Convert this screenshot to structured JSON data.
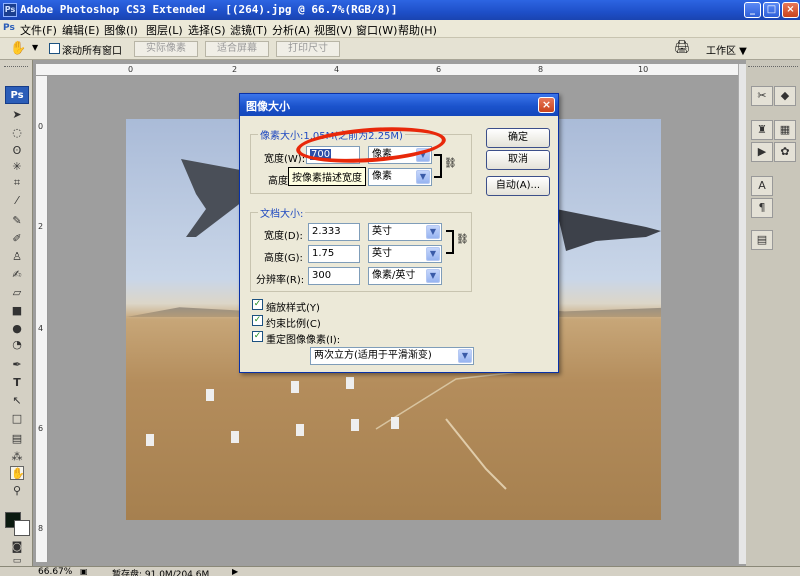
{
  "window": {
    "title": "Adobe Photoshop CS3 Extended - [(264).jpg @ 66.7%(RGB/8)]",
    "app_icon_text": "Ps"
  },
  "menu": [
    "文件(F)",
    "编辑(E)",
    "图像(I)",
    "图层(L)",
    "选择(S)",
    "滤镜(T)",
    "分析(A)",
    "视图(V)",
    "窗口(W)",
    "帮助(H)"
  ],
  "options_bar": {
    "scroll_all": "滚动所有窗口",
    "actual_pixels": "实际像素",
    "fit_screen": "适合屏幕",
    "print_size": "打印尺寸",
    "workspace": "工作区 ▼"
  },
  "toolbox": {
    "logo": "Ps"
  },
  "ruler": {
    "h": [
      "0",
      "2",
      "4",
      "6",
      "8",
      "10"
    ],
    "v": [
      "0",
      "2",
      "4",
      "6",
      "8"
    ]
  },
  "dialog": {
    "title": "图像大小",
    "pixel_dims": {
      "title": "像素大小:1.05M(之前为2.25M)",
      "width_label": "宽度(W):",
      "width_value": "700",
      "width_unit": "像素",
      "height_label": "高度(H):",
      "height_unit": "像素",
      "tooltip": "按像素描述宽度"
    },
    "doc_size": {
      "title": "文档大小:",
      "width_label": "宽度(D):",
      "width_value": "2.333",
      "width_unit": "英寸",
      "height_label": "高度(G):",
      "height_value": "1.75",
      "height_unit": "英寸",
      "res_label": "分辨率(R):",
      "res_value": "300",
      "res_unit": "像素/英寸"
    },
    "checks": [
      {
        "label": "缩放样式(Y)",
        "checked": true
      },
      {
        "label": "约束比例(C)",
        "checked": true
      },
      {
        "label": "重定图像像素(I):",
        "checked": true
      }
    ],
    "resample": "两次立方(适用于平滑渐变)",
    "buttons": {
      "ok": "确定",
      "cancel": "取消",
      "auto": "自动(A)..."
    }
  },
  "status": {
    "zoom": "66.67%",
    "doc": "暂存盘: 91.0M/204.6M"
  },
  "colors": {
    "titlebar": "#1e4fc8",
    "highlight": "#2b4ea8",
    "annotation": "#e8280a"
  }
}
